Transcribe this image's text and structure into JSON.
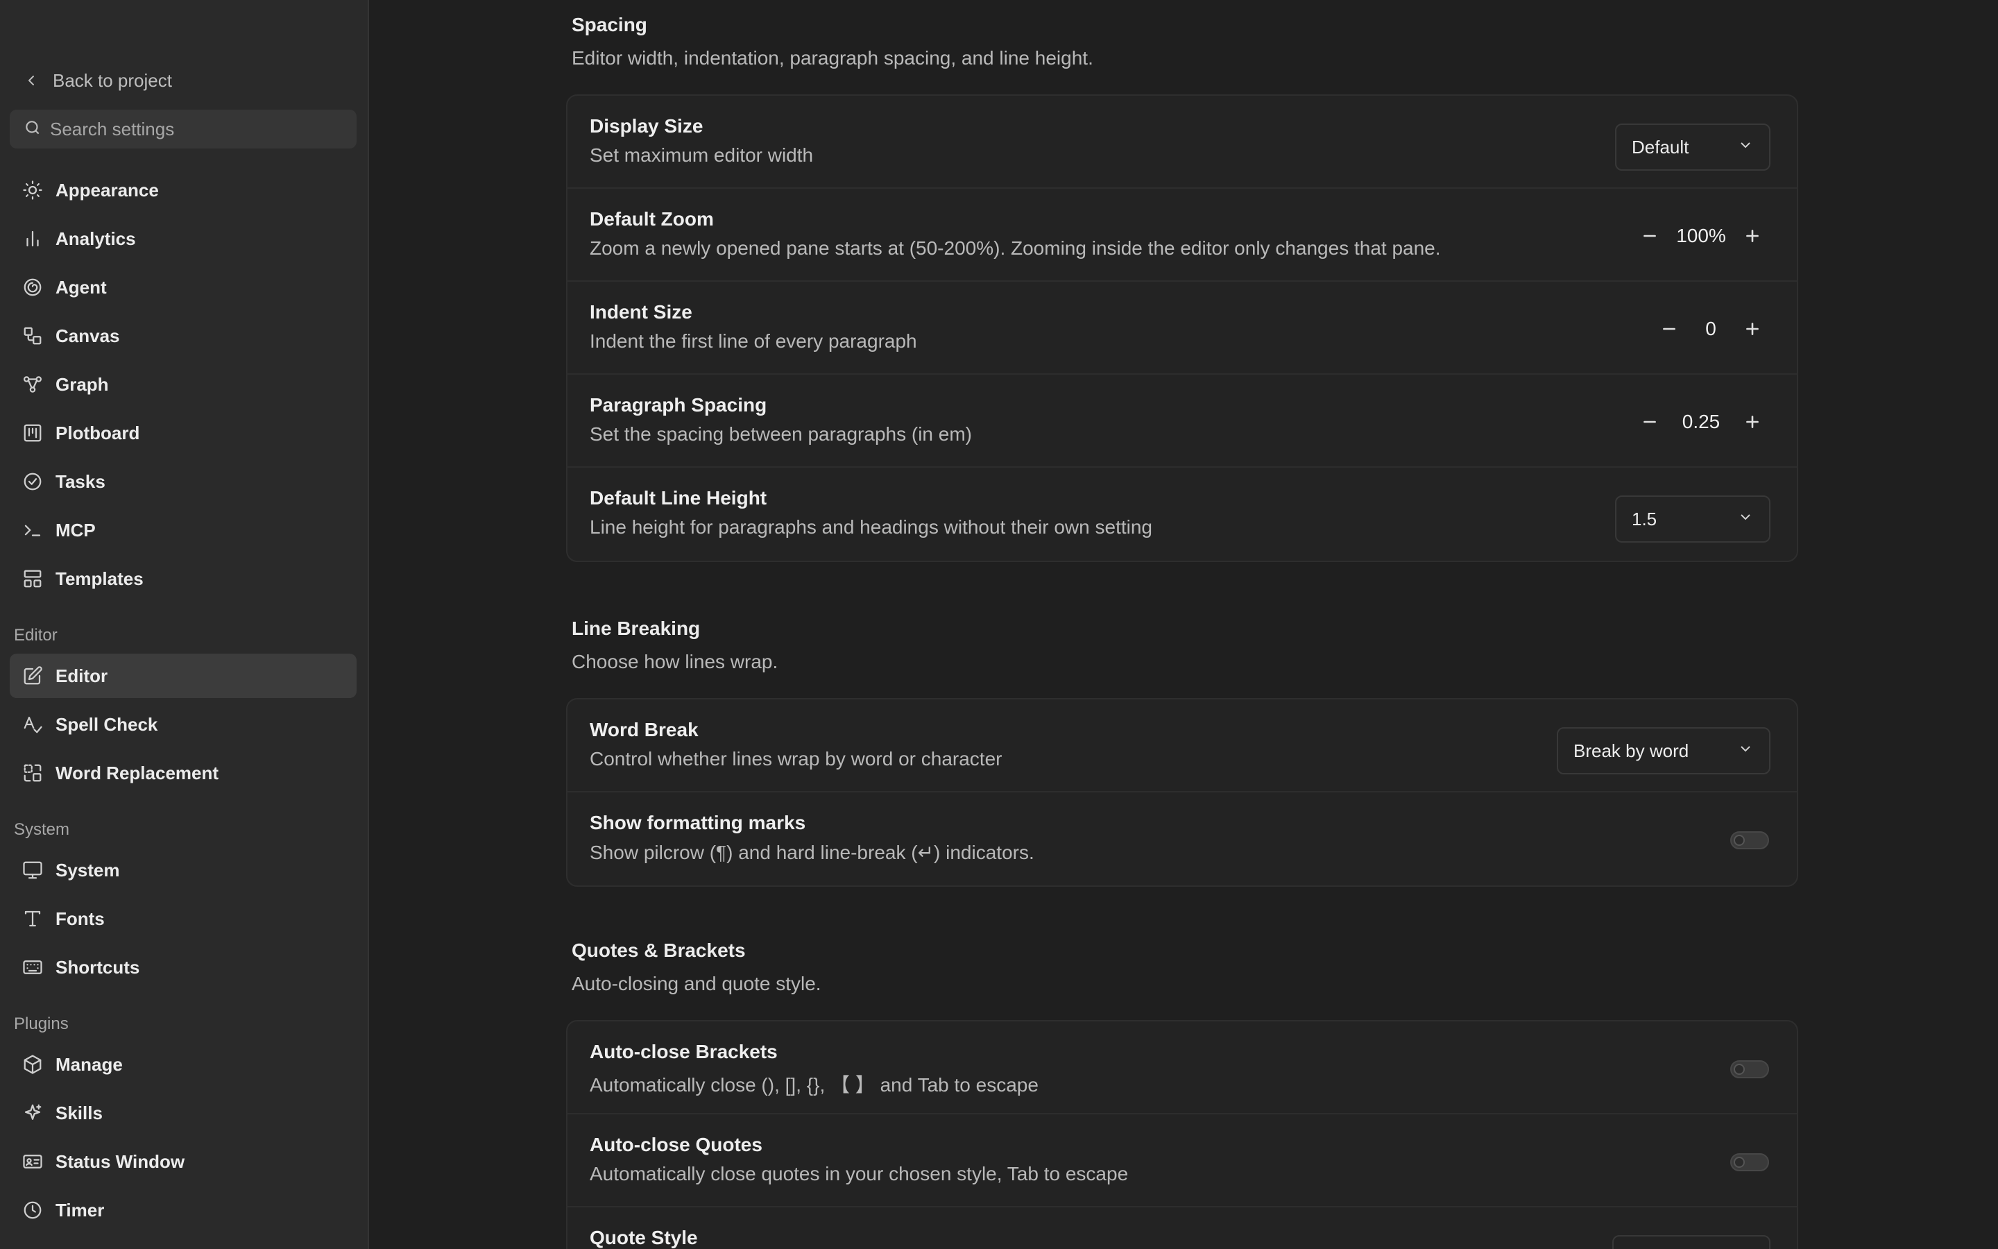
{
  "sidebar": {
    "back_label": "Back to project",
    "search_placeholder": "Search settings",
    "items_top": [
      {
        "label": "Appearance",
        "icon": "sun-icon"
      },
      {
        "label": "Analytics",
        "icon": "bar-chart-icon"
      },
      {
        "label": "Agent",
        "icon": "spiral-icon"
      },
      {
        "label": "Canvas",
        "icon": "shapes-icon"
      },
      {
        "label": "Graph",
        "icon": "graph-nodes-icon"
      },
      {
        "label": "Plotboard",
        "icon": "plotboard-icon"
      },
      {
        "label": "Tasks",
        "icon": "check-circle-icon"
      },
      {
        "label": "MCP",
        "icon": "terminal-icon"
      },
      {
        "label": "Templates",
        "icon": "layout-icon"
      }
    ],
    "group_editor": "Editor",
    "items_editor": [
      {
        "label": "Editor",
        "icon": "pencil-square-icon",
        "active": true
      },
      {
        "label": "Spell Check",
        "icon": "spell-check-icon"
      },
      {
        "label": "Word Replacement",
        "icon": "replace-icon"
      }
    ],
    "group_system": "System",
    "items_system": [
      {
        "label": "System",
        "icon": "monitor-icon"
      },
      {
        "label": "Fonts",
        "icon": "type-icon"
      },
      {
        "label": "Shortcuts",
        "icon": "keyboard-icon"
      }
    ],
    "group_plugins": "Plugins",
    "items_plugins": [
      {
        "label": "Manage",
        "icon": "package-icon"
      },
      {
        "label": "Skills",
        "icon": "sparkle-icon"
      },
      {
        "label": "Status Window",
        "icon": "id-card-icon"
      },
      {
        "label": "Timer",
        "icon": "clock-icon"
      }
    ]
  },
  "spacing": {
    "title": "Spacing",
    "desc": "Editor width, indentation, paragraph spacing, and line height.",
    "display_size": {
      "title": "Display Size",
      "desc": "Set maximum editor width",
      "value": "Default"
    },
    "default_zoom": {
      "title": "Default Zoom",
      "desc": "Zoom a newly opened pane starts at (50-200%). Zooming inside the editor only changes that pane.",
      "value": "100%"
    },
    "indent_size": {
      "title": "Indent Size",
      "desc": "Indent the first line of every paragraph",
      "value": "0"
    },
    "paragraph_spacing": {
      "title": "Paragraph Spacing",
      "desc": "Set the spacing between paragraphs (in em)",
      "value": "0.25"
    },
    "line_height": {
      "title": "Default Line Height",
      "desc": "Line height for paragraphs and headings without their own setting",
      "value": "1.5"
    }
  },
  "line_breaking": {
    "title": "Line Breaking",
    "desc": "Choose how lines wrap.",
    "word_break": {
      "title": "Word Break",
      "desc": "Control whether lines wrap by word or character",
      "value": "Break by word"
    },
    "formatting_marks": {
      "title": "Show formatting marks",
      "desc": "Show pilcrow (¶) and hard line-break (↵) indicators.",
      "enabled": false
    }
  },
  "quotes": {
    "title": "Quotes & Brackets",
    "desc": "Auto-closing and quote style.",
    "auto_brackets": {
      "title": "Auto-close Brackets",
      "desc": "Automatically close (), [], {}, 【 】 and Tab to escape",
      "enabled": false
    },
    "auto_quotes": {
      "title": "Auto-close Quotes",
      "desc": "Automatically close quotes in your chosen style, Tab to escape",
      "enabled": false
    },
    "quote_style": {
      "title": "Quote Style"
    }
  },
  "colors": {
    "background": "#1f1f1f",
    "sidebar": "#2a2a2a",
    "card": "#232323",
    "active_item": "#3c3c3c"
  }
}
